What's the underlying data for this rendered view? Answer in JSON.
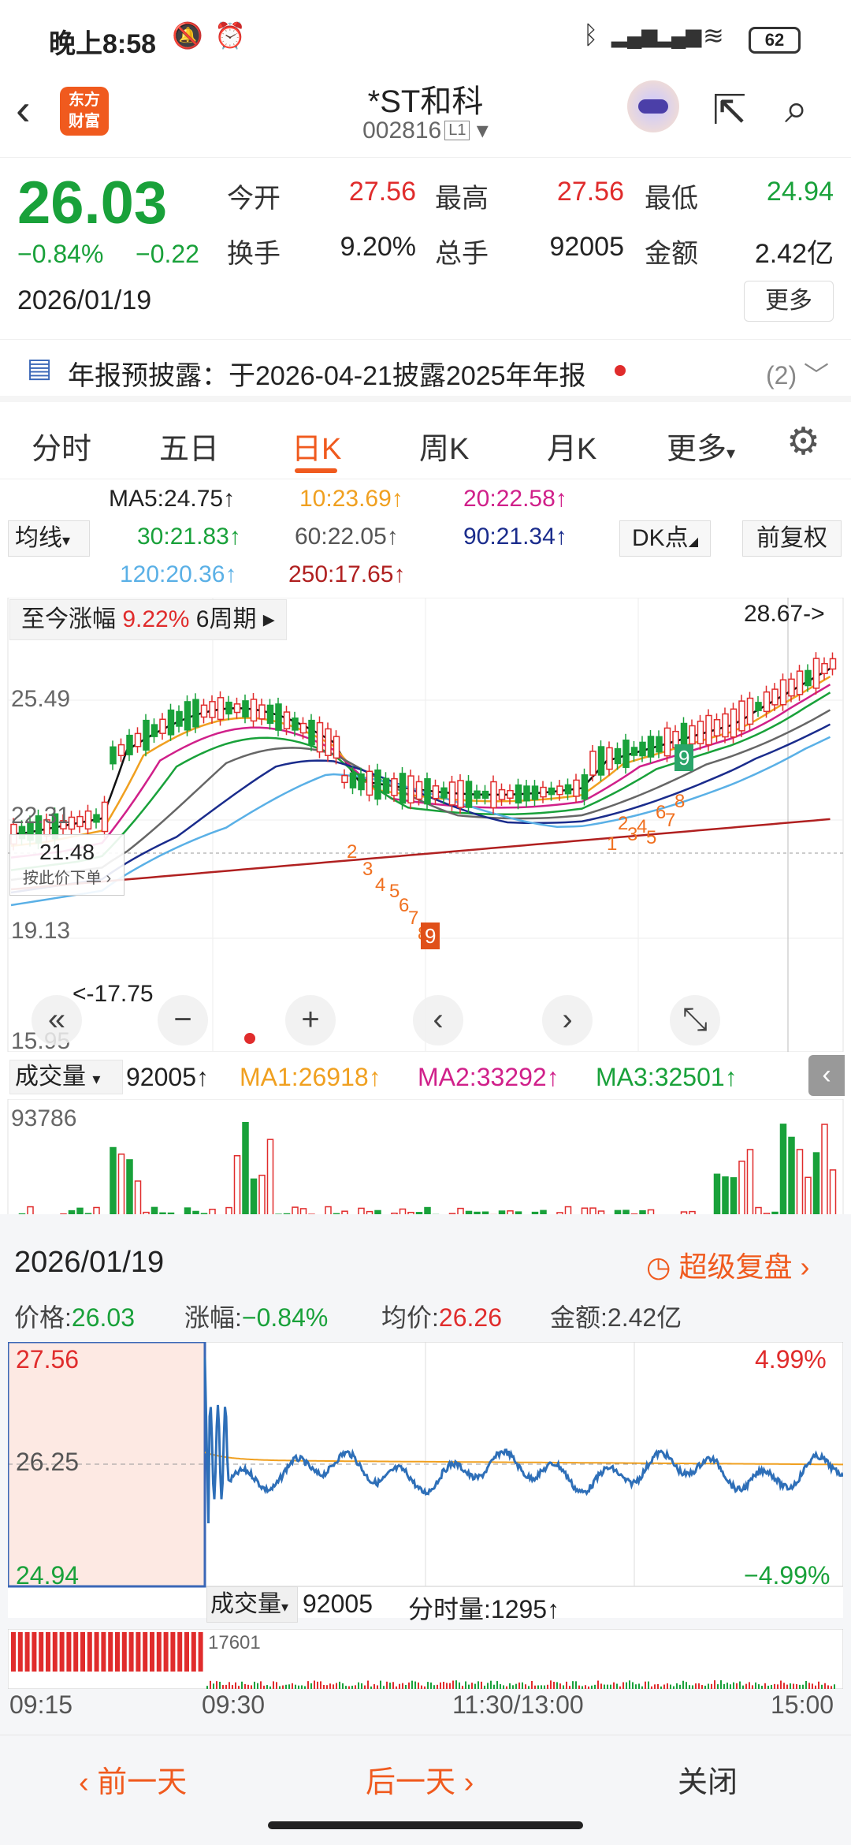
{
  "status_bar": {
    "time": "晚上8:58",
    "battery": "62"
  },
  "header": {
    "logo_line1": "东方",
    "logo_line2": "财富",
    "stock_name": "*ST和科",
    "stock_code": "002816",
    "level_tag": "L1"
  },
  "quote": {
    "price": "26.03",
    "change_pct": "−0.84%",
    "change": "−0.22",
    "date": "2026/01/19",
    "open_label": "今开",
    "open": "27.56",
    "high_label": "最高",
    "high": "27.56",
    "low_label": "最低",
    "low": "24.94",
    "turnover_label": "换手",
    "turnover": "9.20%",
    "volume_label": "总手",
    "volume": "92005",
    "amount_label": "金额",
    "amount": "2.42亿",
    "more": "更多"
  },
  "notice": {
    "text": "年报预披露：于2026-04-21披露2025年年报",
    "count": "(2)"
  },
  "tabs": [
    "分时",
    "五日",
    "日K",
    "周K",
    "月K",
    "更多"
  ],
  "ma_legend": {
    "select": "均线",
    "ma5": "MA5:24.75",
    "ma10": "10:23.69",
    "ma20": "20:22.58",
    "ma30": "30:21.83",
    "ma60": "60:22.05",
    "ma90": "90:21.34",
    "ma120": "120:20.36",
    "ma250": "250:17.65",
    "dk_button": "DK点",
    "fq_button": "前复权"
  },
  "kline": {
    "range_label": "至今涨幅",
    "range_value": "9.22%",
    "period": "6周期",
    "y_labels": [
      "25.49",
      "22.31",
      "19.13",
      "15.95"
    ],
    "max_label": "28.67->",
    "min_label": "<-17.75",
    "marker_value": "21.48",
    "marker_sub": "按此价下单",
    "colors": {
      "ma5": "#111111",
      "ma10": "#f0a020",
      "ma20": "#d0208a",
      "ma30": "#19a13a",
      "ma60": "#666666",
      "ma90": "#1a2c8c",
      "ma120": "#5ab0e6",
      "ma250": "#b02020",
      "up": "#e02c2c",
      "down": "#19a13a"
    }
  },
  "volume": {
    "select": "成交量",
    "vol": "92005",
    "ma1": "MA1:26918",
    "ma2": "MA2:33292",
    "ma3": "MA3:32501",
    "max_label": "93786"
  },
  "replay": {
    "date": "2026/01/19",
    "link": "超级复盘",
    "price_label": "价格:",
    "price": "26.03",
    "chg_label": "涨幅:",
    "chg": "−0.84%",
    "avg_label": "均价:",
    "avg": "26.26",
    "amt_label": "金额:",
    "amt": "2.42亿",
    "high": "27.56",
    "mid": "26.25",
    "low": "24.94",
    "up_pct": "4.99%",
    "down_pct": "−4.99%",
    "vol_select": "成交量",
    "vol": "92005",
    "tick_label": "分时量:1295",
    "vol_max": "17601",
    "times": [
      "09:15",
      "09:30",
      "11:30/13:00",
      "15:00"
    ]
  },
  "bottom_nav": {
    "prev": "前一天",
    "next": "后一天",
    "close": "关闭"
  }
}
